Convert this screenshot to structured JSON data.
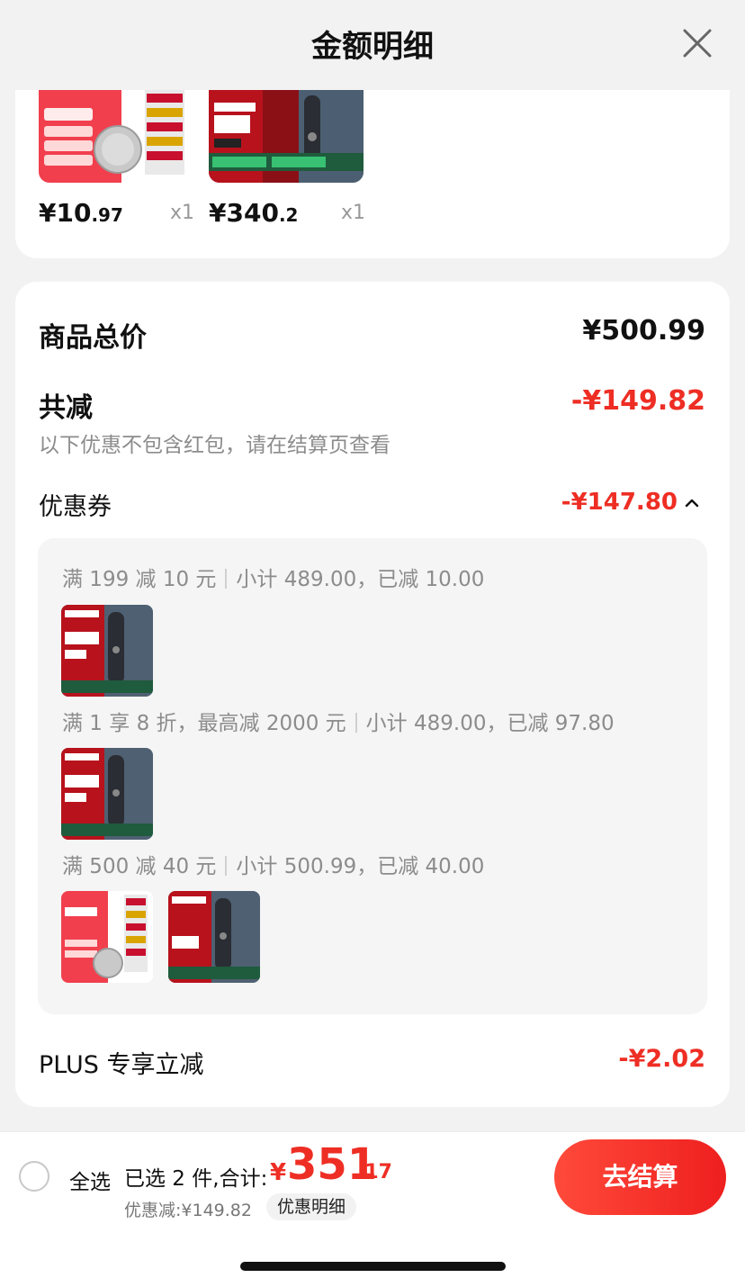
{
  "sheet": {
    "title": "金额明细",
    "close_icon": "close-icon"
  },
  "products": [
    {
      "thumb_name": "panasonic-battery-thumb",
      "price_int": "¥10",
      "price_dec": ".97",
      "qty": "x1"
    },
    {
      "thumb_name": "braun-shaver-thumb",
      "price_int": "¥340",
      "price_dec": ".2",
      "qty": "x1"
    }
  ],
  "summary": {
    "total_label": "商品总价",
    "total_value": "¥500.99",
    "reduce_label": "共减",
    "reduce_value": "-¥149.82",
    "note": "以下优惠不包含红包，请在结算页查看",
    "coupon_label": "优惠券",
    "coupon_value": "-¥147.80"
  },
  "coupon_rules": [
    {
      "condition": "满 199 减 10 元",
      "detail": "小计 489.00，已减 10.00"
    },
    {
      "condition": "满 1 享 8 折，最高减 2000 元",
      "detail": "小计 489.00，已减 97.80"
    },
    {
      "condition": "满 500 减 40 元",
      "detail": "小计 500.99，已减 40.00"
    }
  ],
  "plus": {
    "label": "PLUS 专享立减",
    "value": "-¥2.02"
  },
  "bottom": {
    "select_all": "全选",
    "selected_text": "已选 2 件,合计:",
    "currency": "¥",
    "total_int": "351",
    "total_dec": ".17",
    "discount_text": "优惠减:¥149.82",
    "detail_chip": "优惠明细",
    "checkout": "去结算"
  },
  "colors": {
    "accent_red": "#ee2e24",
    "background": "#f2f2f2"
  }
}
